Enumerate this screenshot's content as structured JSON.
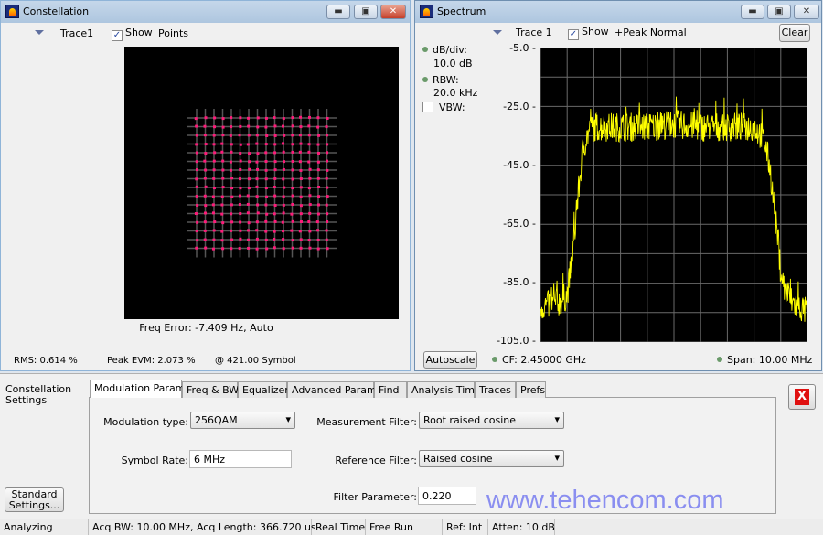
{
  "constellation": {
    "title": "Constellation",
    "trace_label": "Trace1",
    "show_label": "Show",
    "show_checked": true,
    "display_mode": "Points",
    "freq_error": "Freq Error: -7.409 Hz, Auto",
    "rms": "RMS:  0.614 %",
    "peak_evm": "Peak EVM:   2.073 %",
    "at_symbol": "@  421.00 Symbol",
    "point_color": "#ff1a7a",
    "grid_size": 16
  },
  "spectrum": {
    "title": "Spectrum",
    "trace_label": "Trace 1",
    "show_label": "Show",
    "show_checked": true,
    "detector": "+Peak Normal",
    "clear_label": "Clear",
    "db_div_label": "dB/div:",
    "db_div_value": "10.0 dB",
    "rbw_label": "RBW:",
    "rbw_value": "20.0 kHz",
    "vbw_label": "VBW:",
    "vbw_checked": false,
    "autoscale_label": "Autoscale",
    "cf": "CF:  2.45000 GHz",
    "span": "Span:  10.00 MHz"
  },
  "chart_data": {
    "type": "line",
    "trace_color": "#ffff00",
    "x_unit": "MHz offset from CF",
    "xlim": [
      -5,
      5
    ],
    "ylim": [
      -105,
      -5
    ],
    "yticks": [
      "-5.0",
      "-25.0",
      "-45.0",
      "-65.0",
      "-85.0",
      "-105.0"
    ],
    "grid": true,
    "x": [
      -5,
      -4.5,
      -4.2,
      -4.0,
      -3.8,
      -3.6,
      -3.4,
      -3.2,
      -3.0,
      -2,
      -1,
      0,
      1,
      2,
      3.0,
      3.2,
      3.4,
      3.6,
      3.8,
      4.0,
      4.2,
      4.5,
      5
    ],
    "y": [
      -92,
      -91,
      -90,
      -88,
      -75,
      -55,
      -38,
      -33,
      -31,
      -31,
      -31,
      -30,
      -31,
      -31,
      -31,
      -33,
      -36,
      -45,
      -62,
      -80,
      -88,
      -91,
      -94
    ]
  },
  "settings": {
    "panel_title": "Constellation Settings",
    "tabs": [
      "Modulation Params",
      "Freq & BW",
      "Equalizer",
      "Advanced Params",
      "Find",
      "Analysis Time",
      "Traces",
      "Prefs"
    ],
    "active_tab": "Modulation Params",
    "modulation_type_label": "Modulation type:",
    "modulation_type_value": "256QAM",
    "symbol_rate_label": "Symbol Rate:",
    "symbol_rate_value": "6 MHz",
    "measurement_filter_label": "Measurement Filter:",
    "measurement_filter_value": "Root raised cosine",
    "reference_filter_label": "Reference Filter:",
    "reference_filter_value": "Raised cosine",
    "filter_parameter_label": "Filter Parameter:",
    "filter_parameter_value": "0.220",
    "standard_settings_label": "Standard Settings...",
    "close_icon": "red-x-icon"
  },
  "watermark": "www.tehencom.com",
  "status_bar": [
    "Analyzing",
    "Acq BW: 10.00 MHz, Acq Length: 366.720 us",
    "Real Time",
    "Free Run",
    "Ref: Int",
    "Atten: 10 dB"
  ]
}
